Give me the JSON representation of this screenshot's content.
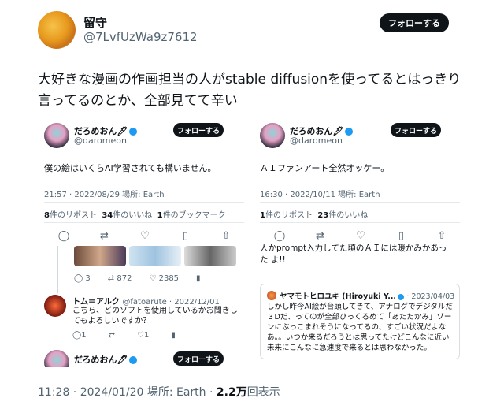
{
  "author": {
    "name": "留守",
    "handle": "@7LvfUzWa9z7612"
  },
  "follow_label": "フォローする",
  "tweet_text": "大好きな漫画の作画担当の人がstable diffusionを使ってるとはっきり言ってるのとか、全部見てて辛い",
  "left_shot": {
    "name": "だろめおん🖊",
    "handle": "@daromeon",
    "text": "僕の絵はいくらAI学習されても構いません。",
    "meta": "21:57 · 2022/08/29 場所: Earth",
    "retweets": "8",
    "retweets_label": "件のリポスト",
    "likes": "34",
    "likes_label": "件のいいね",
    "bookmarks": "1",
    "bookmarks_label": "件のブックマーク",
    "reply_stats": {
      "replies": "3",
      "retweets": "872",
      "likes": "2385"
    },
    "reply": {
      "name": "トム＝アルク",
      "handle": "@fatoarute · 2022/12/01",
      "text": "こちら、どのソフトを使用しているかお聞きしてもよろしいですか？",
      "replies": "1",
      "likes": "1"
    },
    "bottom_name": "だろめおん🖊"
  },
  "right_shot": {
    "name": "だろめおん🖊",
    "handle": "@daromeon",
    "text": "ＡＩファンアート全然オッケー。",
    "meta": "16:30 · 2022/10/11 場所: Earth",
    "retweets": "1",
    "retweets_label": "件のリポスト",
    "likes": "23",
    "likes_label": "件のいいね",
    "cut_text": "人かprompt入力してた頃のＡＩには暖かみかあった よ!!",
    "quote": {
      "name": "ヤマモトヒロユキ (Hiroyuki Y...",
      "date": "· 2023/04/03",
      "text": "しかし昨今AI絵が台頭してきて、アナログでデジタルだ３Dだ、ってのが全部ひっくるめて「あたたかみ」ゾーンにぶっこまれそうになってるの、すごい状況だよなあ。。いつか来るだろうとは思ってたけどこんなに近い未来にこんなに急速度で来るとは思わなかった。"
    }
  },
  "footer": {
    "time": "11:28 · 2024/01/20 場所: Earth · ",
    "views": "2.2万",
    "views_label": "回表示"
  }
}
